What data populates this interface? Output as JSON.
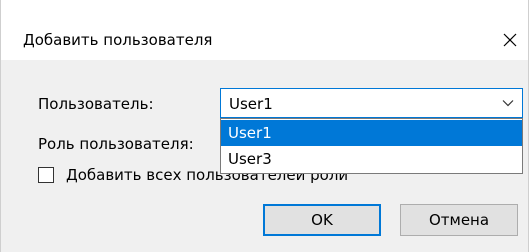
{
  "dialog": {
    "title": "Добавить пользователя",
    "close_icon": "close-icon"
  },
  "form": {
    "user_label": "Пользователь:",
    "user_value": "User1",
    "user_options": [
      "User1",
      "User3"
    ],
    "role_label": "Роль пользователя: ",
    "add_all_checkbox_label": "Добавить всех пользователей роли",
    "add_all_checked": false
  },
  "buttons": {
    "ok": "OK",
    "cancel": "Отмена"
  },
  "colors": {
    "accent": "#0078d7",
    "dialog_bg": "#f0f0f0",
    "button_bg": "#e1e1e1"
  }
}
